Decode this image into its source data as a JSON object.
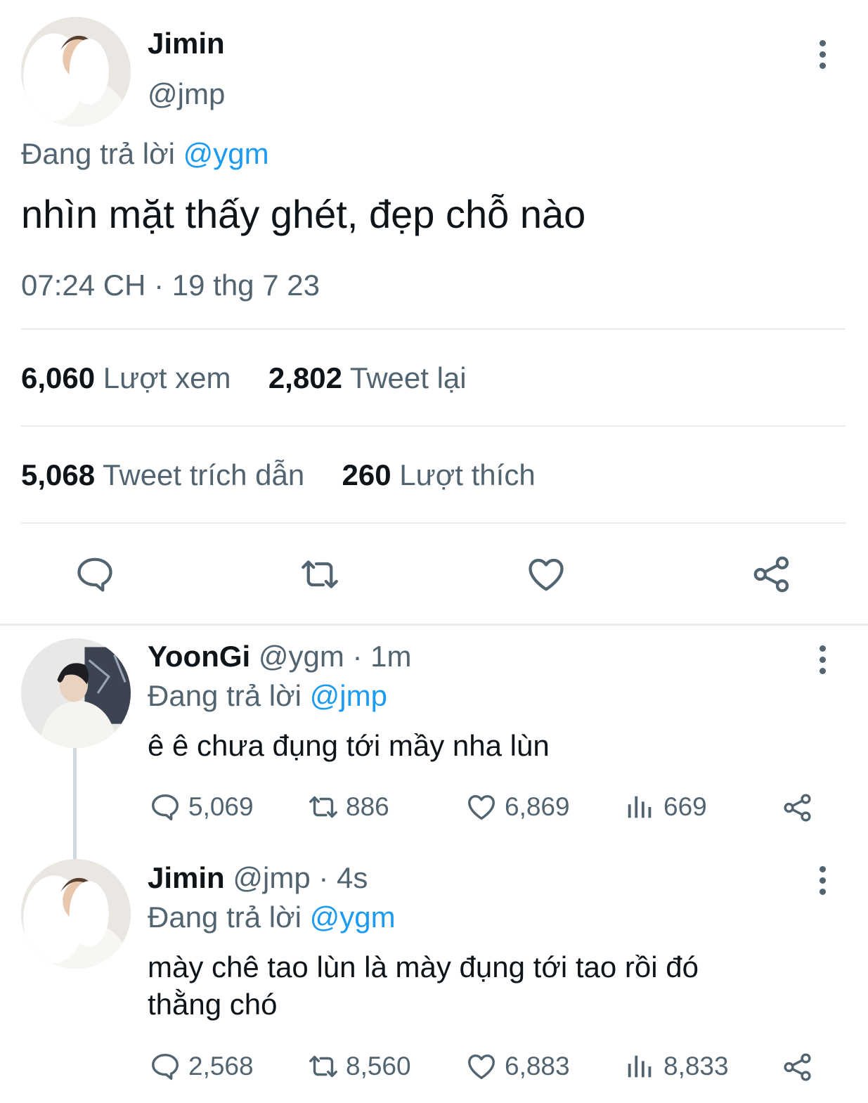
{
  "main_tweet": {
    "display_name": "Jimin",
    "handle": "@jmp",
    "reply_prefix": "Đang trả lời",
    "reply_to": "@ygm",
    "text": "nhìn mặt thấy ghét, đẹp chỗ nào",
    "timestamp": "07:24 CH · 19 thg 7 23",
    "stats": {
      "views_count": "6,060",
      "views_label": "Lượt xem",
      "retweets_count": "2,802",
      "retweets_label": "Tweet lại",
      "quotes_count": "5,068",
      "quotes_label": "Tweet trích dẫn",
      "likes_count": "260",
      "likes_label": "Lượt thích"
    },
    "actions": [
      "reply-icon",
      "retweet-icon",
      "like-icon",
      "share-icon"
    ]
  },
  "replies": [
    {
      "display_name": "YoonGi",
      "handle_time": "@ygm · 1m",
      "reply_prefix": "Đang trả lời",
      "reply_to": "@jmp",
      "text": "ê ê chưa đụng tới mầy nha lùn",
      "replies": "5,069",
      "retweets": "886",
      "likes": "6,869",
      "views": "669"
    },
    {
      "display_name": "Jimin",
      "handle_time": "@jmp · 4s",
      "reply_prefix": "Đang trả lời",
      "reply_to": "@ygm",
      "text_line1": "mày chê tao lùn là mày đụng tới tao rồi đó",
      "text_line2": "thằng chó",
      "replies": "2,568",
      "retweets": "8,560",
      "likes": "6,883",
      "views": "8,833"
    }
  ],
  "colors": {
    "text": "#0f1419",
    "secondary": "#536471",
    "accent": "#1d9bf0",
    "divider": "#e6ecf0"
  }
}
